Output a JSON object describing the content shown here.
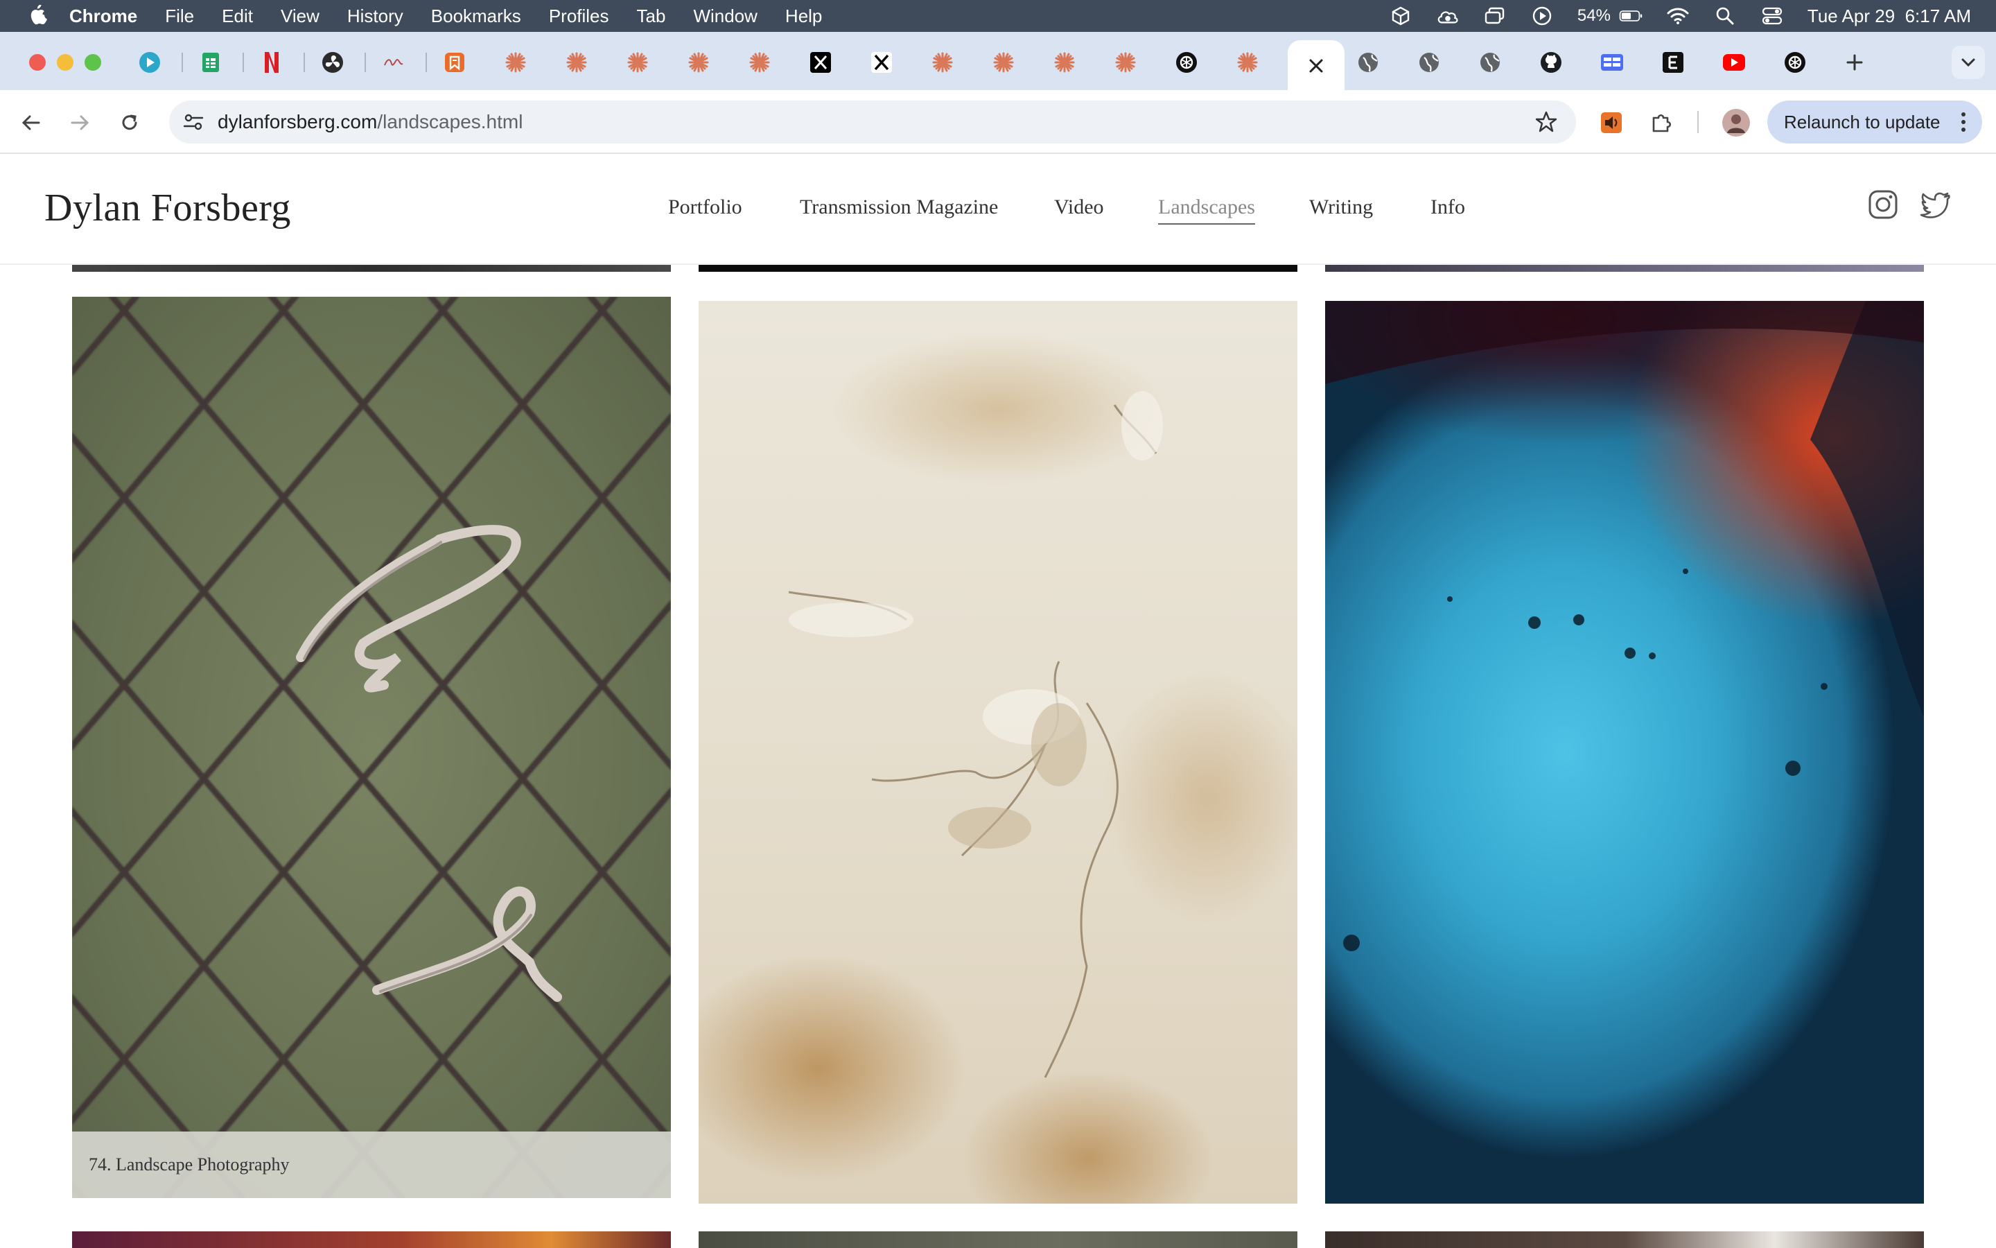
{
  "menubar": {
    "app_name": "Chrome",
    "items": [
      "File",
      "Edit",
      "View",
      "History",
      "Bookmarks",
      "Profiles",
      "Tab",
      "Window",
      "Help"
    ],
    "battery_percent": "54%",
    "datetime": "Tue Apr 29  6:17 AM"
  },
  "browser": {
    "url_domain": "dylanforsberg.com",
    "url_path": "/landscapes.html",
    "relaunch_label": "Relaunch to update",
    "active_tab_icon": "close-icon",
    "tab_icons": [
      "media-play-icon",
      "sheets-icon",
      "netflix-icon",
      "fan-icon",
      "wave-icon",
      "bookmark-app-icon",
      "claude-icon",
      "claude-icon",
      "claude-icon",
      "claude-icon",
      "claude-icon",
      "x-icon",
      "x-icon",
      "claude-icon",
      "claude-icon",
      "claude-icon",
      "claude-icon",
      "openai-icon",
      "claude-icon",
      "globe-icon",
      "globe-icon",
      "globe-icon",
      "github-icon",
      "app-grid-icon",
      "e-icon",
      "youtube-icon",
      "openai-icon"
    ]
  },
  "site": {
    "title": "Dylan Forsberg",
    "nav": [
      {
        "label": "Portfolio",
        "active": false
      },
      {
        "label": "Transmission Magazine",
        "active": false
      },
      {
        "label": "Video",
        "active": false
      },
      {
        "label": "Landscapes",
        "active": true
      },
      {
        "label": "Writing",
        "active": false
      },
      {
        "label": "Info",
        "active": false
      }
    ],
    "social": [
      "instagram-icon",
      "twitter-icon"
    ]
  },
  "gallery": {
    "caption": "74. Landscape Photography"
  }
}
